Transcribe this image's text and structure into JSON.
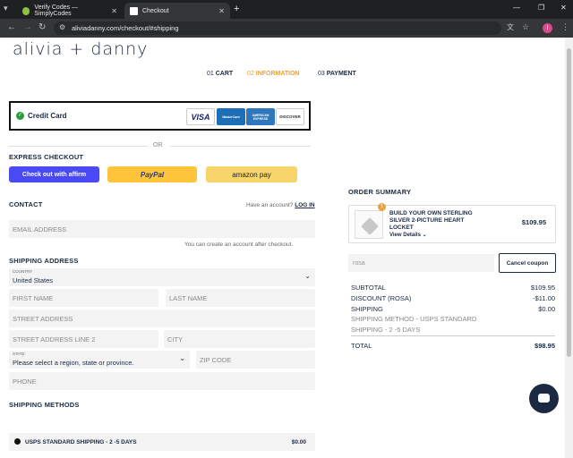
{
  "browser": {
    "tabs": [
      {
        "title": "Verify Codes — SimplyCodes"
      },
      {
        "title": "Checkout"
      }
    ],
    "url": "aliviadanny.com/checkout/#shipping",
    "profile_initial": "I"
  },
  "brand": {
    "logo": "alivia + danny"
  },
  "steps": [
    {
      "num": "01",
      "label": "CART"
    },
    {
      "num": "02",
      "label": "INFORMATION"
    },
    {
      "num": "03",
      "label": "PAYMENT"
    }
  ],
  "payment": {
    "credit_card_label": "Credit Card",
    "cards": [
      "VISA",
      "MasterCard",
      "AMERICAN EXPRESS",
      "DISCOVER"
    ],
    "or": "OR"
  },
  "express": {
    "title": "EXPRESS CHECKOUT",
    "affirm": "Check out with affirm",
    "paypal": "PayPal",
    "amazon": "amazon pay"
  },
  "contact": {
    "title": "CONTACT",
    "have_account": "Have an account?",
    "login": "LOG IN",
    "email_placeholder": "EMAIL ADDRESS",
    "note": "You can create an account after checkout."
  },
  "shipping_address": {
    "title": "SHIPPING ADDRESS",
    "country_label": "COUNTRY",
    "country_value": "United States",
    "first_name": "FIRST NAME",
    "last_name": "LAST NAME",
    "street": "STREET ADDRESS",
    "street2": "STREET ADDRESS LINE 2",
    "city": "CITY",
    "state_label": "STATE",
    "state_value": "Please select a region, state or province.",
    "zip": "ZIP CODE",
    "phone": "PHONE"
  },
  "shipping_methods": {
    "title": "SHIPPING METHODS",
    "option": "USPS STANDARD SHIPPING - 2 -5 DAYS",
    "price": "$0.00"
  },
  "order_summary": {
    "title": "ORDER SUMMARY",
    "item": {
      "qty": "1",
      "name": "BUILD YOUR OWN STERLING SILVER 2-PICTURE HEART LOCKET",
      "view_details": "View Details",
      "price": "$109.95"
    },
    "coupon_value": "rosa",
    "cancel_coupon": "Cancel coupon",
    "subtotal_label": "SUBTOTAL",
    "subtotal": "$109.95",
    "discount_label": "DISCOUNT (ROSA)",
    "discount": "-$11.00",
    "shipping_label": "SHIPPING",
    "shipping": "$0.00",
    "shipping_method": "SHIPPING METHOD - USPS STANDARD SHIPPING - 2 -5 DAYS",
    "total_label": "TOTAL",
    "total": "$98.95"
  },
  "colors": {
    "accent_orange": "#e8a33c",
    "navy": "#1b2a41",
    "affirm": "#4a4af4",
    "paypal": "#ffc439",
    "amazon": "#f7d56b"
  }
}
